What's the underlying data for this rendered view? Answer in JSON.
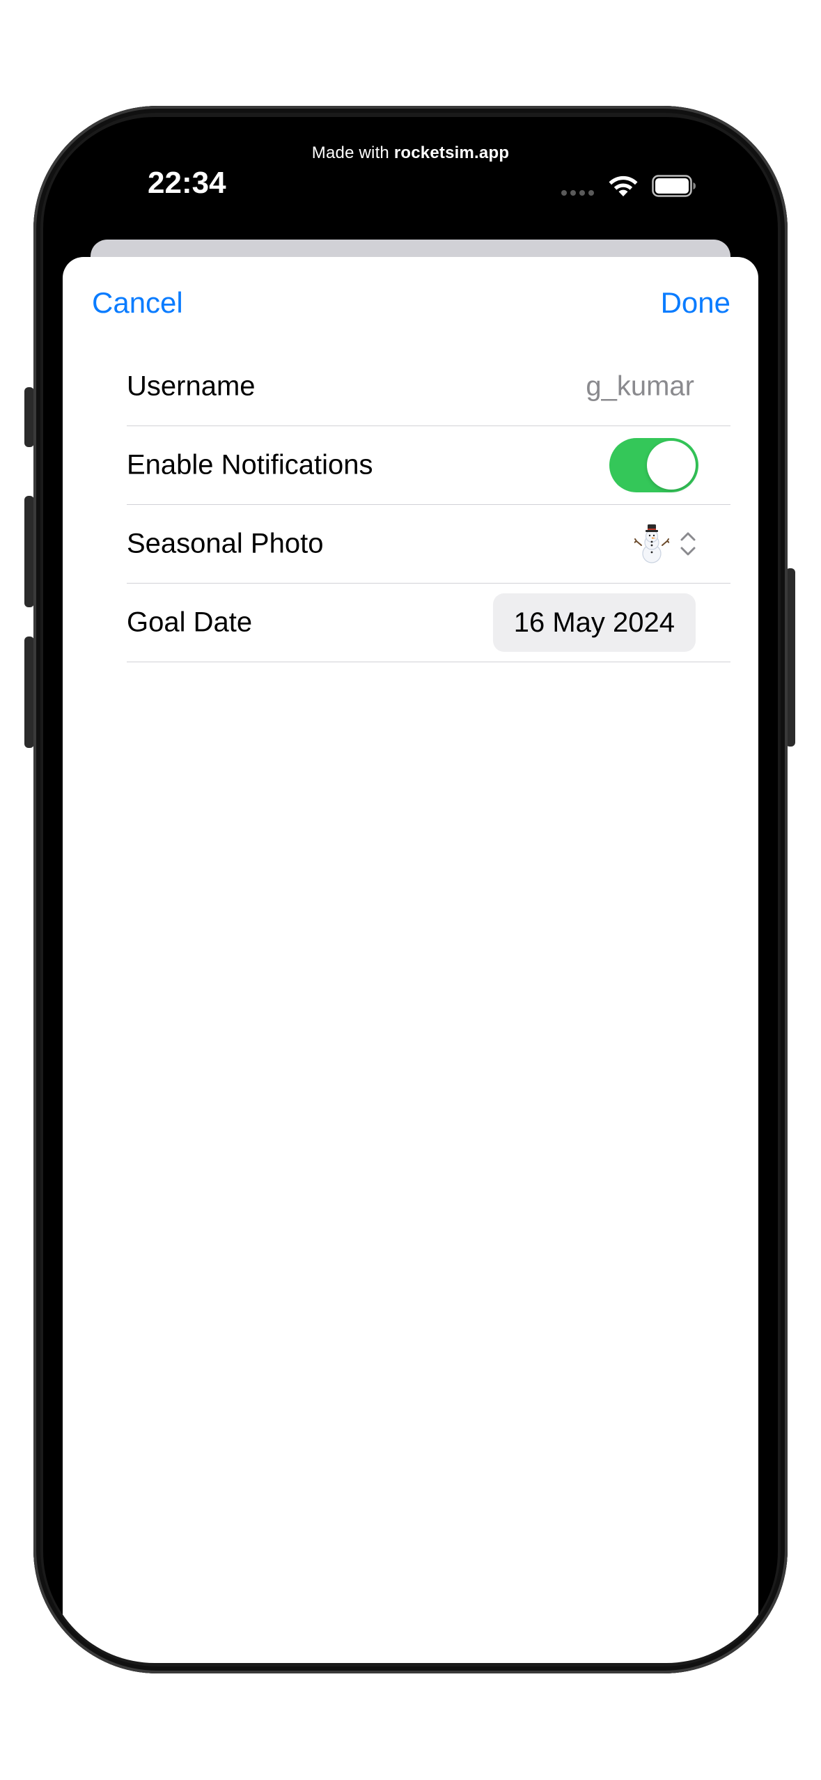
{
  "status_bar": {
    "watermark_prefix": "Made with ",
    "watermark_brand": "rocketsim.app",
    "time": "22:34"
  },
  "nav": {
    "cancel_label": "Cancel",
    "done_label": "Done"
  },
  "form": {
    "username": {
      "label": "Username",
      "value": "g_kumar"
    },
    "notifications": {
      "label": "Enable Notifications",
      "enabled": true
    },
    "seasonal_photo": {
      "label": "Seasonal Photo",
      "selected_icon": "snowman-icon"
    },
    "goal_date": {
      "label": "Goal Date",
      "value": "16 May 2024"
    }
  },
  "colors": {
    "accent": "#0a7cff",
    "toggle_on": "#34c759",
    "secondary_text": "#8a8a8e"
  }
}
